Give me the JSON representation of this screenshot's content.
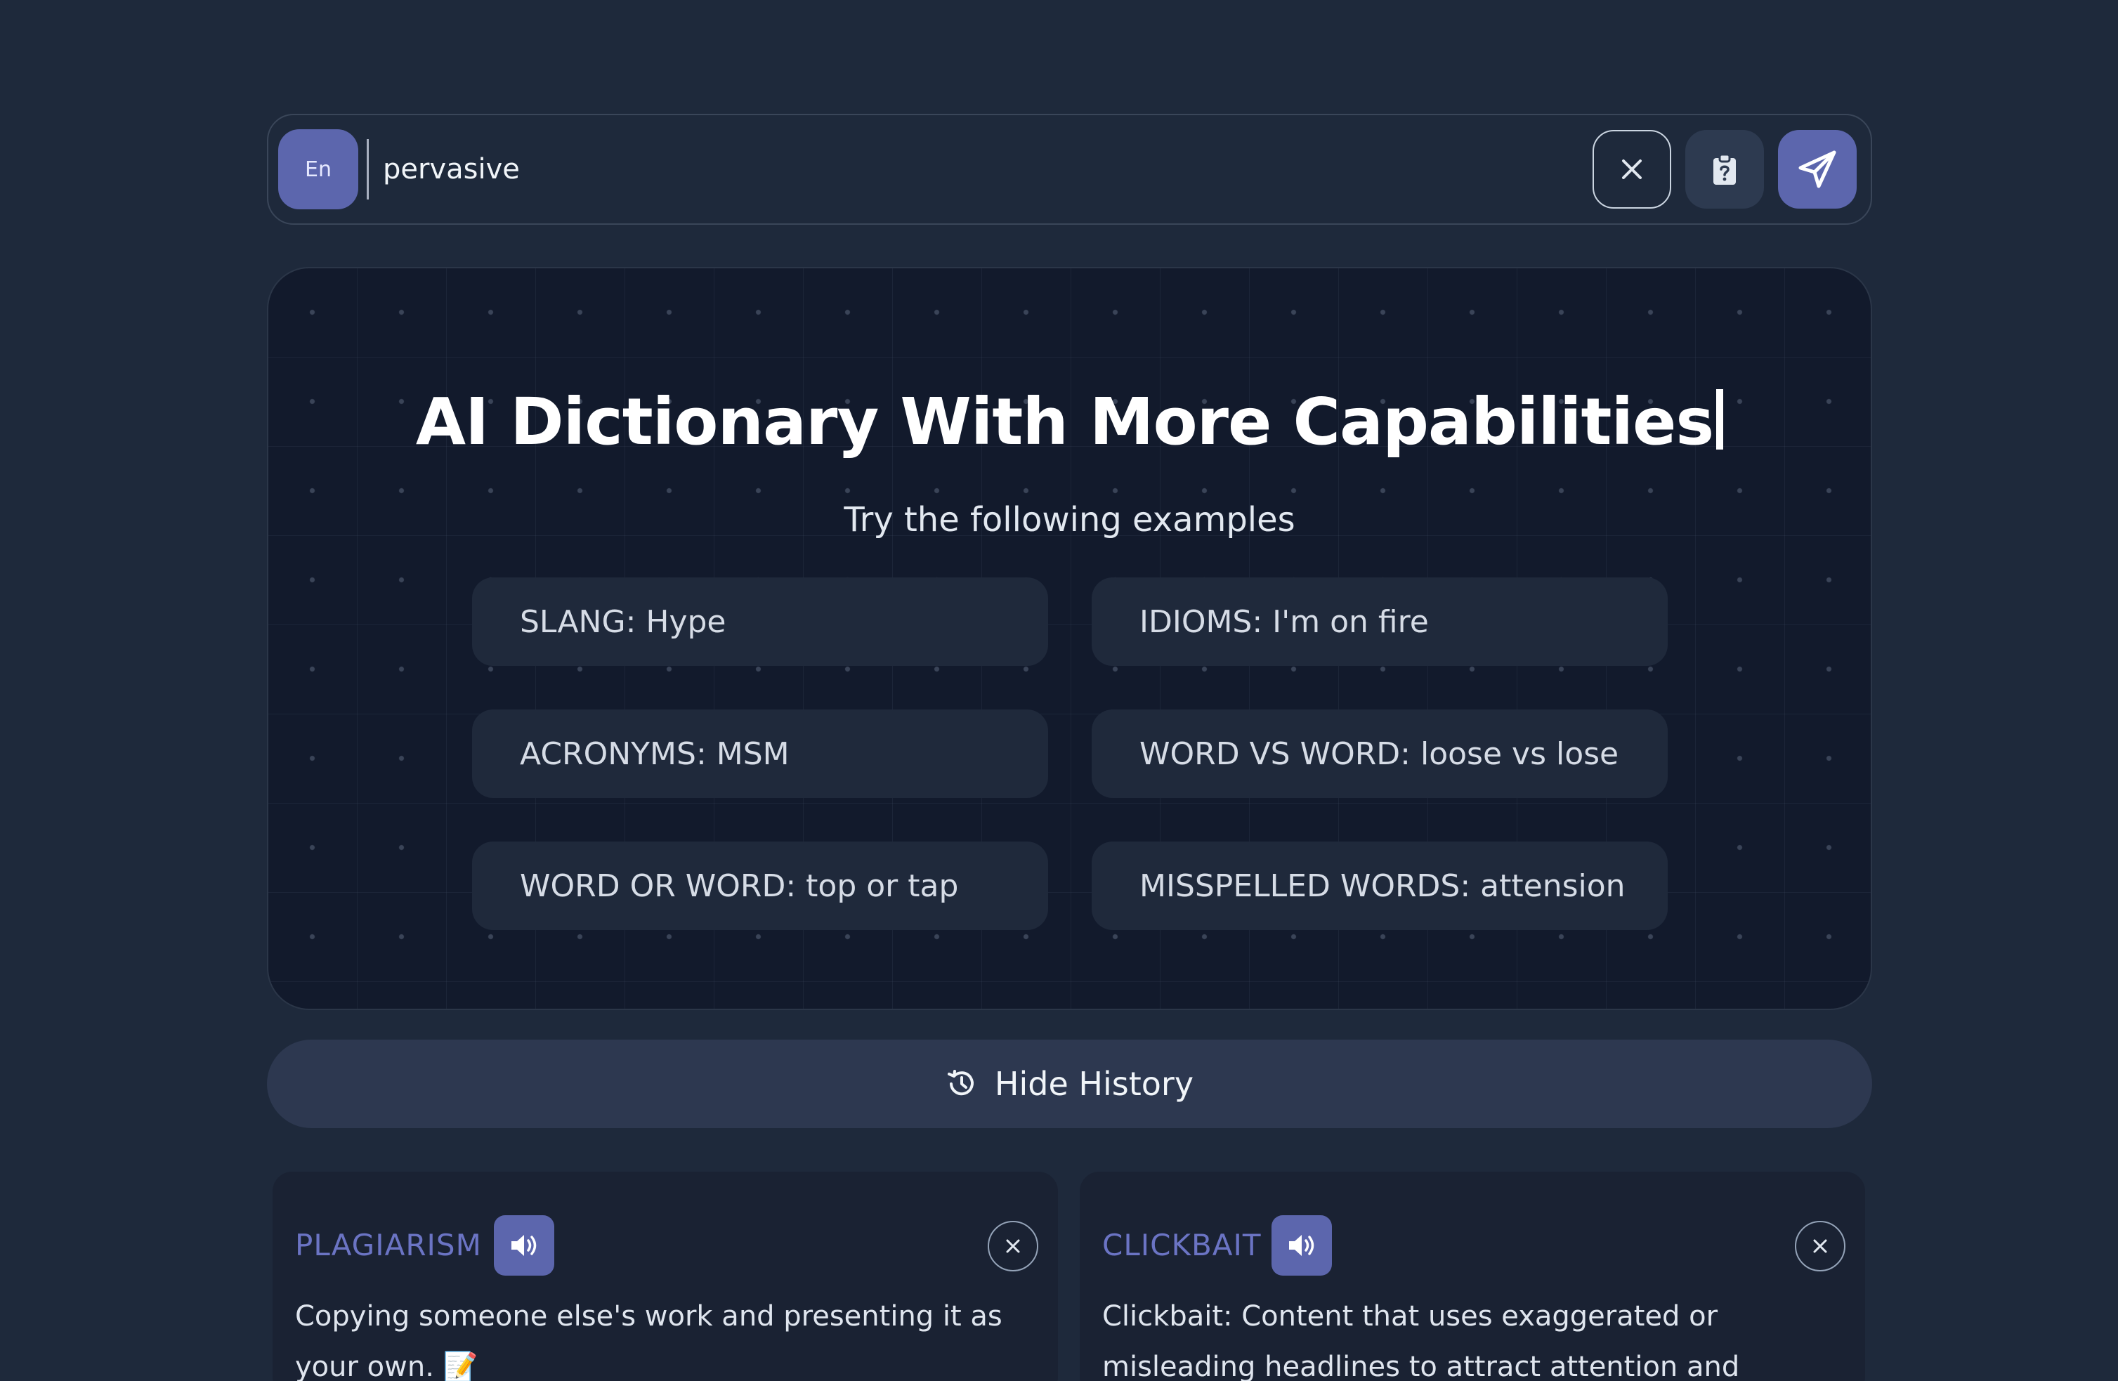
{
  "search": {
    "language_label": "En",
    "value": "pervasive",
    "clear_icon": "close-icon",
    "paste_icon": "clipboard-question-icon",
    "send_icon": "paper-plane-icon"
  },
  "hero": {
    "title": "AI Dictionary With More Capabilities",
    "subtitle": "Try the following examples",
    "examples": [
      "SLANG: Hype",
      "IDIOMS: I'm on fire",
      "ACRONYMS: MSM",
      "WORD VS WORD: loose vs lose",
      "WORD OR WORD: top or tap",
      "MISSPELLED WORDS: attension"
    ]
  },
  "history": {
    "toggle_label": "Hide History",
    "toggle_icon": "history-icon",
    "cards": [
      {
        "word": "PLAGIARISM",
        "definition": "Copying someone else's work and presenting it as your own. 📝"
      },
      {
        "word": "CLICKBAIT",
        "definition": "Clickbait: Content that uses exaggerated or misleading headlines to attract attention and encourage clicks,"
      }
    ]
  },
  "colors": {
    "background": "#1e293b",
    "accent": "#5c66ad",
    "card_word": "#6b74c4"
  }
}
